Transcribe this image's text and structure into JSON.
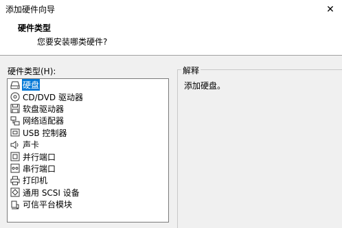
{
  "window": {
    "title": "添加硬件向导",
    "close_symbol": "✕"
  },
  "header": {
    "title": "硬件类型",
    "subtitle": "您要安装哪类硬件?"
  },
  "hardware_list": {
    "label": "硬件类型(H):",
    "items": [
      {
        "label": "硬盘",
        "icon": "hard-disk-icon",
        "selected": true
      },
      {
        "label": "CD/DVD 驱动器",
        "icon": "cd-dvd-icon"
      },
      {
        "label": "软盘驱动器",
        "icon": "floppy-icon"
      },
      {
        "label": "网络适配器",
        "icon": "network-adapter-icon"
      },
      {
        "label": "USB 控制器",
        "icon": "usb-icon"
      },
      {
        "label": "声卡",
        "icon": "speaker-icon"
      },
      {
        "label": "并行端口",
        "icon": "parallel-port-icon"
      },
      {
        "label": "串行端口",
        "icon": "serial-port-icon"
      },
      {
        "label": "打印机",
        "icon": "printer-icon"
      },
      {
        "label": "通用 SCSI 设备",
        "icon": "scsi-icon"
      },
      {
        "label": "可信平台模块",
        "icon": "tpm-icon"
      }
    ]
  },
  "explanation": {
    "label": "解释",
    "text": "添加硬盘。"
  },
  "colors": {
    "selection": "#0078d7",
    "background": "#f0f0f0",
    "header_bg": "#ffffff"
  }
}
